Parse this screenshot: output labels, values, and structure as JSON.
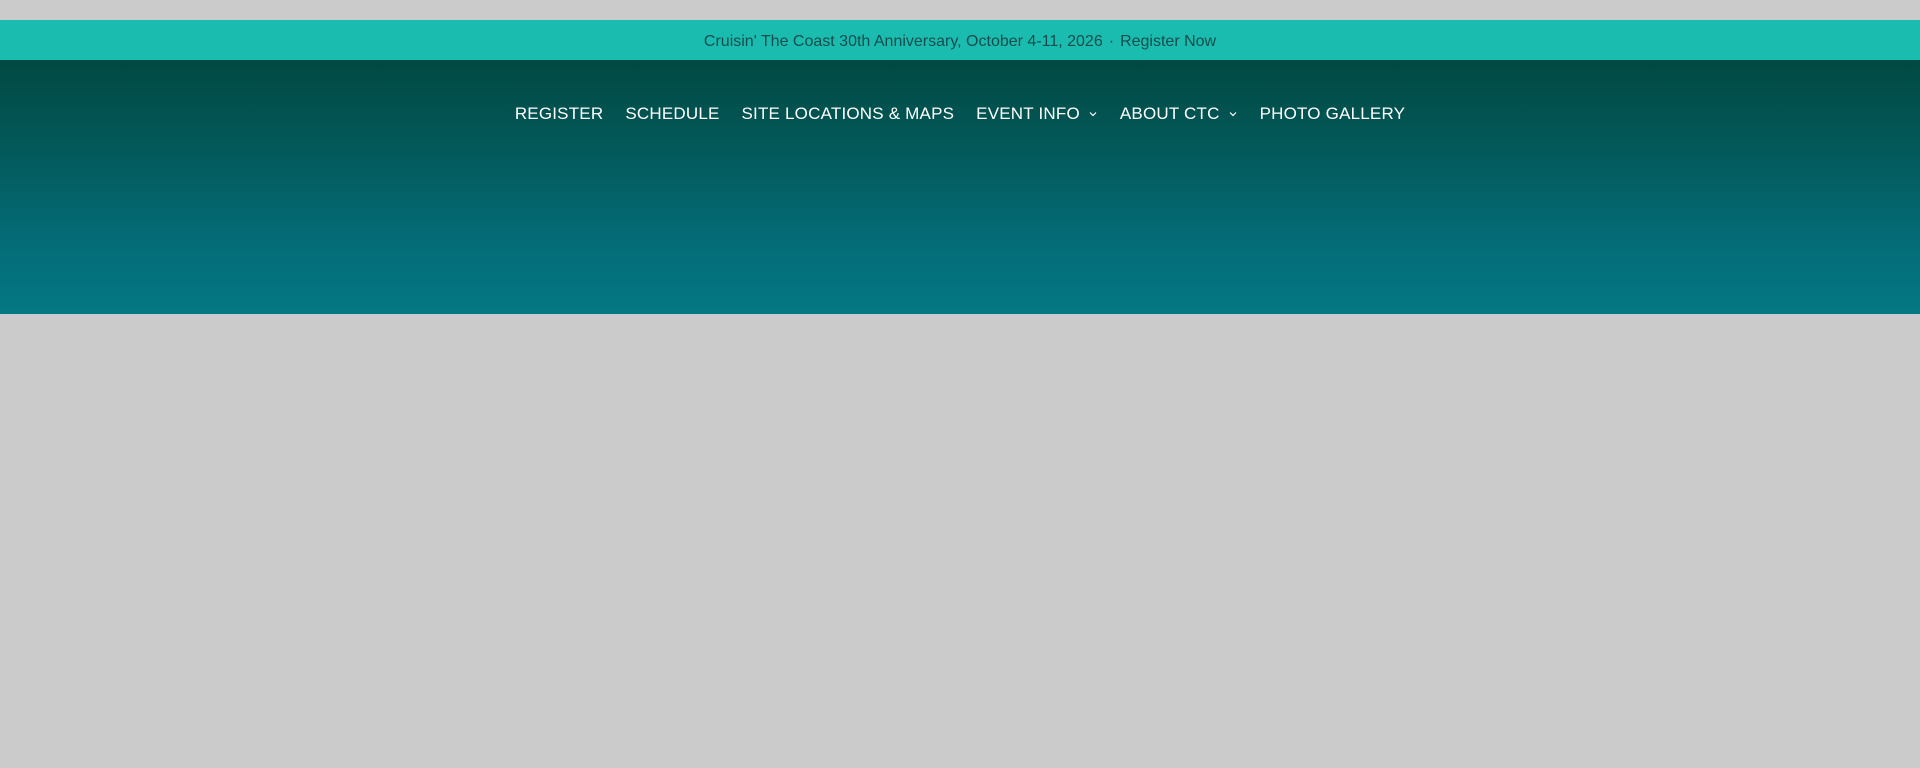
{
  "announcement": {
    "text": "Cruisin' The Coast 30th Anniversary, October 4-11, 2026",
    "separator": "·",
    "link_label": "Register Now"
  },
  "nav": {
    "items": [
      {
        "label": "REGISTER",
        "has_dropdown": false
      },
      {
        "label": "SCHEDULE",
        "has_dropdown": false
      },
      {
        "label": "SITE LOCATIONS & MAPS",
        "has_dropdown": false
      },
      {
        "label": "EVENT INFO",
        "has_dropdown": true,
        "icon": "chevron-down-icon"
      },
      {
        "label": "ABOUT CTC",
        "has_dropdown": true,
        "icon": "chevron-down-icon"
      },
      {
        "label": "PHOTO GALLERY",
        "has_dropdown": false
      }
    ]
  },
  "colors": {
    "announcement_bg": "#1abcb0",
    "announcement_text": "#184c4c",
    "hero_top": "#014942",
    "hero_bottom": "#047884",
    "page_bg": "#cbcbcb",
    "nav_text": "#ffffff"
  }
}
